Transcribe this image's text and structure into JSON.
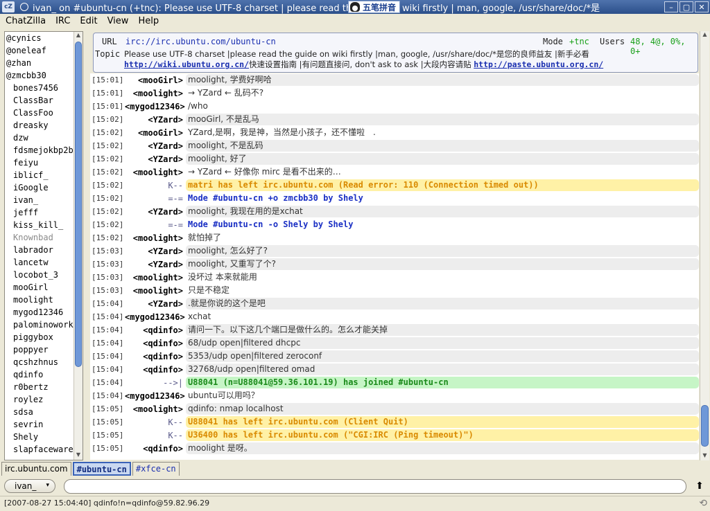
{
  "window": {
    "app_icon": "cZ",
    "title": "ivan_ on #ubuntu-cn (+tnc): Please use UTF-8 charset | please read the guide on wiki firstly | man, google, /usr/share/doc/*是",
    "ime_label": "五笔拼音",
    "btn_minimize": "–",
    "btn_maximize": "▢",
    "btn_close": "✕"
  },
  "menu": [
    "ChatZilla",
    "IRC",
    "Edit",
    "View",
    "Help"
  ],
  "users": [
    {
      "name": "@cynics",
      "cls": "op"
    },
    {
      "name": "@oneleaf",
      "cls": "op"
    },
    {
      "name": "@zhan",
      "cls": "op"
    },
    {
      "name": "@zmcbb30",
      "cls": "op"
    },
    {
      "name": "bones7456",
      "cls": "reg"
    },
    {
      "name": "ClassBar",
      "cls": "reg"
    },
    {
      "name": "ClassFoo",
      "cls": "reg"
    },
    {
      "name": "dreasky",
      "cls": "reg"
    },
    {
      "name": "dzw",
      "cls": "reg"
    },
    {
      "name": "fdsmejokbp2b…",
      "cls": "reg"
    },
    {
      "name": "feiyu",
      "cls": "reg"
    },
    {
      "name": "iblicf_",
      "cls": "reg"
    },
    {
      "name": "iGoogle",
      "cls": "reg"
    },
    {
      "name": "ivan_",
      "cls": "reg"
    },
    {
      "name": "jefff",
      "cls": "reg"
    },
    {
      "name": "kiss_kill_",
      "cls": "reg"
    },
    {
      "name": "Knownbad",
      "cls": "reg away"
    },
    {
      "name": "labrador",
      "cls": "reg"
    },
    {
      "name": "lancetw",
      "cls": "reg"
    },
    {
      "name": "locobot_3",
      "cls": "reg"
    },
    {
      "name": "mooGirl",
      "cls": "reg"
    },
    {
      "name": "moolight",
      "cls": "reg"
    },
    {
      "name": "mygod12346",
      "cls": "reg"
    },
    {
      "name": "palominowork…",
      "cls": "reg"
    },
    {
      "name": "piggybox",
      "cls": "reg"
    },
    {
      "name": "poppyer",
      "cls": "reg"
    },
    {
      "name": "qcshzhnus",
      "cls": "reg"
    },
    {
      "name": "qdinfo",
      "cls": "reg"
    },
    {
      "name": "r0bertz",
      "cls": "reg"
    },
    {
      "name": "roylez",
      "cls": "reg"
    },
    {
      "name": "sdsa",
      "cls": "reg"
    },
    {
      "name": "sevrin",
      "cls": "reg"
    },
    {
      "name": "Shely",
      "cls": "reg"
    },
    {
      "name": "slapfaceware",
      "cls": "reg"
    }
  ],
  "header": {
    "url_label": "URL",
    "url_value": "irc://irc.ubuntu.com/ubuntu-cn",
    "mode_label": "Mode",
    "mode_value": "+tnc",
    "users_label": "Users",
    "users_value": "48, 4@, 0%, 0+",
    "topic_label": "Topic",
    "topic_text1": "Please use UTF-8 charset |please read the guide on wiki firstly |man, google, /usr/share/doc/*是您的良师益友 |新手必看 ",
    "topic_link1": "http://wiki.ubuntu.org.cn/",
    "topic_text2": "快速设置指南 |有问题直接问, don't ask to ask |大段内容请贴 ",
    "topic_link2": "http://paste.ubuntu.org.cn/"
  },
  "messages": [
    {
      "time": "[15:01]",
      "nick": "<mooGirl>",
      "text": "moolight, 学费好啊哈",
      "style": "gray",
      "nick_style": ""
    },
    {
      "time": "[15:01]",
      "nick": "<moolight>",
      "text": "→ YZard ← 乱码不?",
      "style": "plain",
      "nick_style": ""
    },
    {
      "time": "[15:01]",
      "nick": "<mygod12346>",
      "text": "/who",
      "style": "plain",
      "nick_style": ""
    },
    {
      "time": "[15:02]",
      "nick": "<YZard>",
      "text": "mooGirl, 不是乱马",
      "style": "gray",
      "nick_style": ""
    },
    {
      "time": "[15:02]",
      "nick": "<mooGirl>",
      "text": "YZard,是啊，我是神，当然是小孩子，还不懂啦　.",
      "style": "plain",
      "nick_style": ""
    },
    {
      "time": "[15:02]",
      "nick": "<YZard>",
      "text": "moolight, 不是乱码",
      "style": "gray",
      "nick_style": ""
    },
    {
      "time": "[15:02]",
      "nick": "<YZard>",
      "text": "moolight, 好了",
      "style": "gray",
      "nick_style": ""
    },
    {
      "time": "[15:02]",
      "nick": "<moolight>",
      "text": "→ YZard ← 好像你 mirc 是看不出来的…",
      "style": "plain",
      "nick_style": ""
    },
    {
      "time": "[15:02]",
      "nick": "K--",
      "text": "matri has left irc.ubuntu.com (Read error: 110 (Connection timed out))",
      "style": "yellow",
      "nick_style": "sym"
    },
    {
      "time": "[15:02]",
      "nick": "=-=",
      "text": "Mode #ubuntu-cn +o zmcbb30  by Shely",
      "style": "blue",
      "nick_style": "sym"
    },
    {
      "time": "[15:02]",
      "nick": "<YZard>",
      "text": "moolight, 我现在用的是xchat",
      "style": "gray",
      "nick_style": ""
    },
    {
      "time": "[15:02]",
      "nick": "=-=",
      "text": "Mode #ubuntu-cn -o Shely  by Shely",
      "style": "blue",
      "nick_style": "sym"
    },
    {
      "time": "[15:02]",
      "nick": "<moolight>",
      "text": "就怕掉了",
      "style": "plain",
      "nick_style": ""
    },
    {
      "time": "[15:03]",
      "nick": "<YZard>",
      "text": "moolight, 怎么好了?",
      "style": "gray",
      "nick_style": ""
    },
    {
      "time": "[15:03]",
      "nick": "<YZard>",
      "text": "moolight, 又重写了个?",
      "style": "gray",
      "nick_style": ""
    },
    {
      "time": "[15:03]",
      "nick": "<moolight>",
      "text": "没坏过 本来就能用",
      "style": "plain",
      "nick_style": ""
    },
    {
      "time": "[15:03]",
      "nick": "<moolight>",
      "text": "只是不稳定",
      "style": "plain",
      "nick_style": ""
    },
    {
      "time": "[15:04]",
      "nick": "<YZard>",
      "text": ".就是你说的这个是吧",
      "style": "gray",
      "nick_style": ""
    },
    {
      "time": "[15:04]",
      "nick": "<mygod12346>",
      "text": "xchat",
      "style": "plain",
      "nick_style": ""
    },
    {
      "time": "[15:04]",
      "nick": "<qdinfo>",
      "text": "请问一下。以下这几个端口是做什么的。怎么才能关掉",
      "style": "gray",
      "nick_style": ""
    },
    {
      "time": "[15:04]",
      "nick": "<qdinfo>",
      "text": "68/udp   open|filtered dhcpc",
      "style": "gray",
      "nick_style": ""
    },
    {
      "time": "[15:04]",
      "nick": "<qdinfo>",
      "text": "5353/udp open|filtered zeroconf",
      "style": "gray",
      "nick_style": ""
    },
    {
      "time": "[15:04]",
      "nick": "<qdinfo>",
      "text": "32768/udp open|filtered omad",
      "style": "gray",
      "nick_style": ""
    },
    {
      "time": "[15:04]",
      "nick": "-->|",
      "text": "U88041 (n=U88041@59.36.101.19) has joined #ubuntu-cn",
      "style": "green",
      "nick_style": "sym"
    },
    {
      "time": "[15:04]",
      "nick": "<mygod12346>",
      "text": "ubuntu可以用吗？",
      "style": "plain",
      "nick_style": ""
    },
    {
      "time": "[15:05]",
      "nick": "<moolight>",
      "text": "qdinfo: nmap localhost",
      "style": "gray",
      "nick_style": ""
    },
    {
      "time": "[15:05]",
      "nick": "K--",
      "text": "U88041 has left irc.ubuntu.com (Client Quit)",
      "style": "yellow",
      "nick_style": "sym"
    },
    {
      "time": "[15:05]",
      "nick": "K--",
      "text": "U36400 has left irc.ubuntu.com (\"CGI:IRC (Ping timeout)\")",
      "style": "yellow",
      "nick_style": "sym"
    },
    {
      "time": "[15:05]",
      "nick": "<qdinfo>",
      "text": "moolight 是呀。",
      "style": "gray",
      "nick_style": ""
    }
  ],
  "tabs": [
    {
      "label": "irc.ubuntu.com",
      "cls": ""
    },
    {
      "label": "#ubuntu-cn",
      "cls": "active"
    },
    {
      "label": "#xfce-cn",
      "cls": "hl"
    }
  ],
  "input": {
    "nick": "ivan_",
    "dropdown_icon": "▾",
    "multiline_icon": "⬆",
    "value": ""
  },
  "status": {
    "text": "[2007-08-27 15:04:40] qdinfo!n=qdinfo@59.82.96.29",
    "grip_icon": "⟲"
  },
  "scroll_arrows": {
    "up": "▲",
    "down": "▼"
  }
}
